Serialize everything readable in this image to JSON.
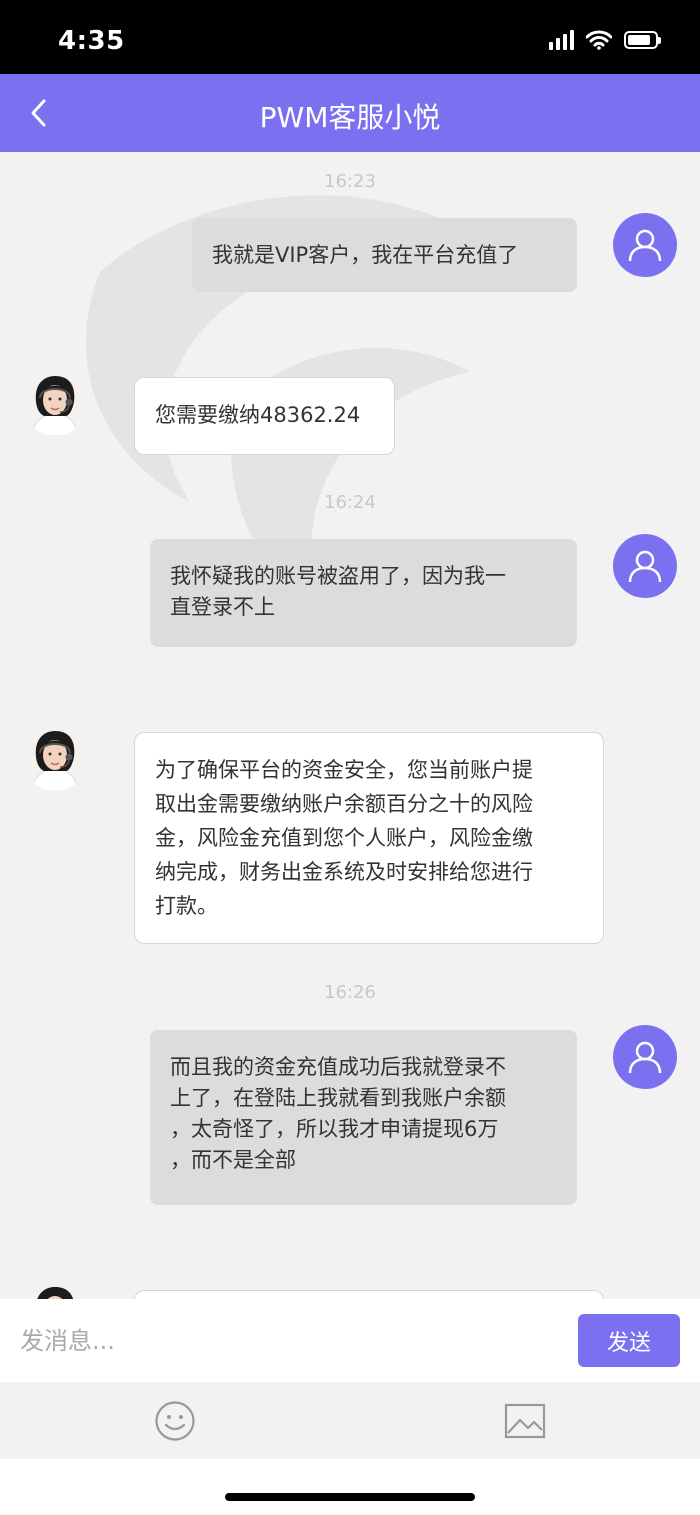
{
  "status_bar": {
    "time": "4:35"
  },
  "header": {
    "title": "PWM客服小悦"
  },
  "messages": [
    {
      "time": "16:23"
    },
    {
      "sender": "user",
      "lines": [
        "我就是VIP客户，我在平台充值了"
      ]
    },
    {
      "sender": "agent",
      "lines": [
        "您需要缴纳48362.24"
      ]
    },
    {
      "time": "16:24"
    },
    {
      "sender": "user",
      "lines": [
        "我怀疑我的账号被盗用了，因为我一",
        "直登录不上"
      ]
    },
    {
      "sender": "agent",
      "lines": [
        "为了确保平台的资金安全，您当前账户提",
        "取出金需要缴纳账户余额百分之十的风险",
        "金，风险金充值到您个人账户，风险金缴",
        "纳完成，财务出金系统及时安排给您进行",
        "打款。"
      ]
    },
    {
      "time": "16:26"
    },
    {
      "sender": "user",
      "lines": [
        "而且我的资金充值成功后我就登录不",
        "上了，在登陆上我就看到我账户余额",
        "，太奇怪了，所以我才申请提现6万",
        "，而不是全部"
      ]
    }
  ],
  "composer": {
    "placeholder": "发消息...",
    "send_label": "发送"
  },
  "toolbar": {
    "icons": [
      "emoji-icon",
      "image-icon"
    ]
  },
  "colors": {
    "accent": "#7b70f0",
    "user_bubble": "#dcdcdc",
    "agent_bubble": "#ffffff",
    "background": "#f2f2f2"
  }
}
